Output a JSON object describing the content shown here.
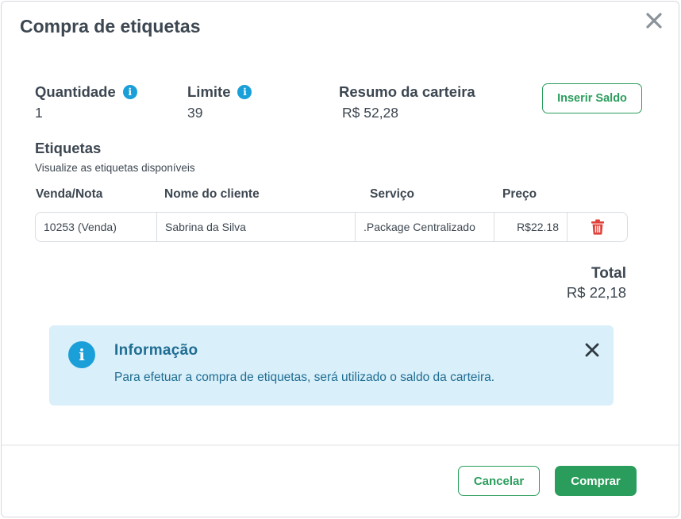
{
  "modal": {
    "title": "Compra de etiquetas"
  },
  "stats": {
    "quantidade": {
      "label": "Quantidade",
      "value": "1"
    },
    "limite": {
      "label": "Limite",
      "value": "39"
    },
    "carteira": {
      "label": "Resumo da carteira",
      "value": "R$ 52,28"
    }
  },
  "actions": {
    "inserir_saldo": "Inserir Saldo",
    "cancelar": "Cancelar",
    "comprar": "Comprar"
  },
  "etiquetas": {
    "title": "Etiquetas",
    "subtitle": "Visualize as etiquetas disponíveis",
    "columns": [
      "Venda/Nota",
      "Nome do cliente",
      "Serviço",
      "Preço"
    ],
    "rows": [
      {
        "venda_nota": "10253 (Venda)",
        "cliente": "Sabrina da Silva",
        "servico": ".Package Centralizado",
        "preco": "R$22.18"
      }
    ]
  },
  "total": {
    "label": "Total",
    "value": "R$ 22,18"
  },
  "alert": {
    "title": "Informação",
    "text": "Para efetuar a compra de etiquetas, será utilizado o saldo da carteira."
  },
  "colors": {
    "primary_green": "#2a9d5c",
    "info_blue": "#1b9fd9",
    "alert_bg": "#d9eff9",
    "alert_text": "#1f6d93",
    "danger_red": "#e0403a"
  },
  "icons": {
    "close": "close-icon",
    "info": "info-icon",
    "trash": "trash-icon"
  }
}
